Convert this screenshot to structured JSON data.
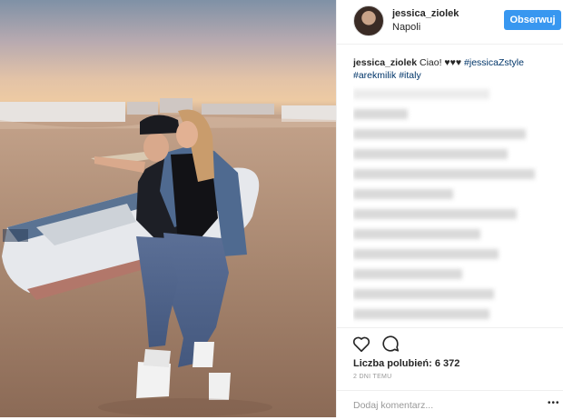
{
  "post": {
    "author": "jessica_ziolek",
    "location": "Napoli",
    "follow_label": "Obserwuj",
    "caption": {
      "username": "jessica_ziolek",
      "text": "Ciao! ♥♥♥",
      "tag_jessica": "#jessicaZstyle",
      "tag_arek": "#arekmilik",
      "tag_italy": "#italy"
    },
    "likes_label": "Liczba polubień: 6 372",
    "timestamp": "2 DNI TEMU",
    "comment_placeholder": "Dodaj komentarz...",
    "more_label": "•••",
    "icons": {
      "like": "heart-icon",
      "comment": "comment-bubble-icon",
      "more": "more-options-icon"
    },
    "colors": {
      "follow_button": "#3897f0",
      "hashtag": "#003569",
      "divider": "#efefef"
    }
  }
}
